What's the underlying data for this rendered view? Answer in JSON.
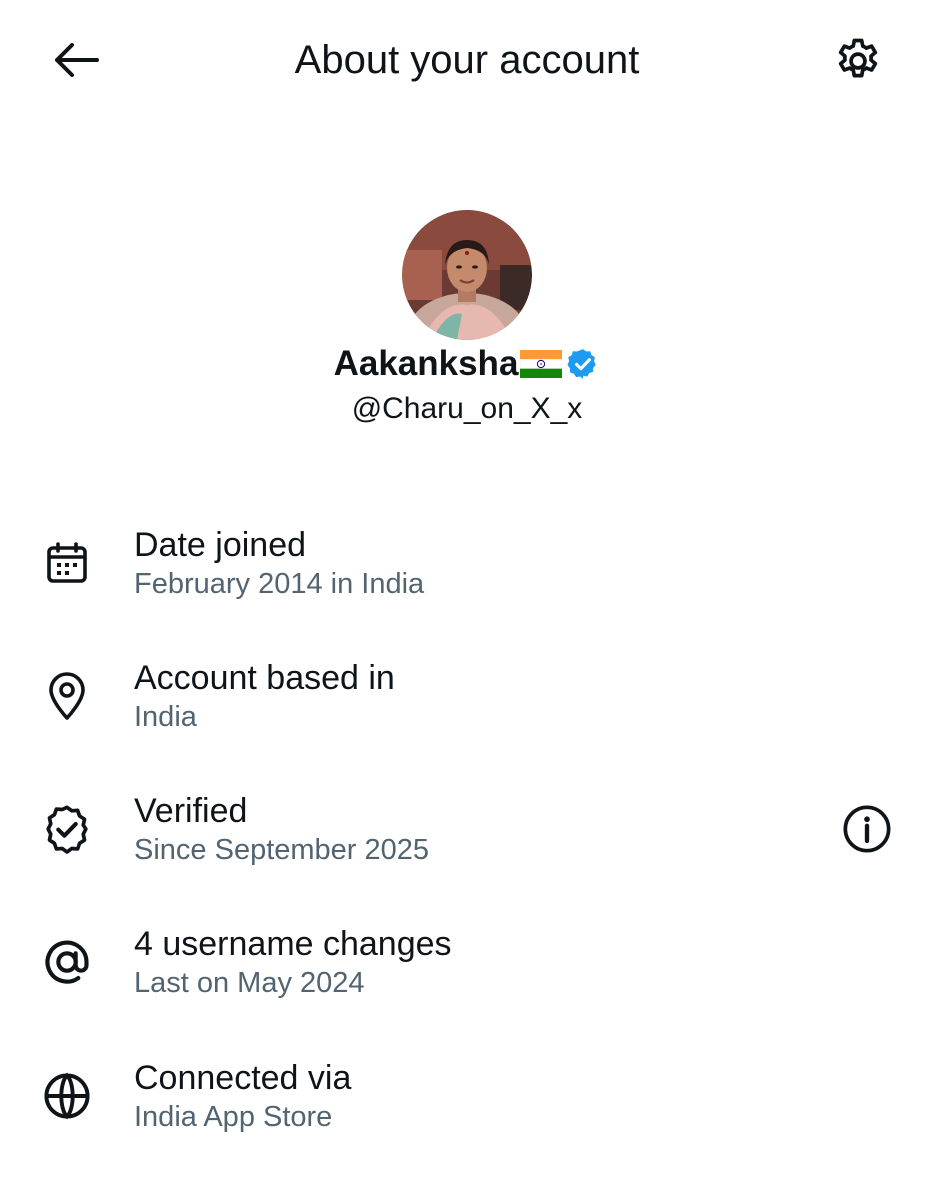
{
  "header": {
    "title": "About your account",
    "back_icon": "arrow-left-icon",
    "settings_icon": "gear-icon"
  },
  "profile": {
    "name": "Aakanksha",
    "flag": "india-flag-emoji",
    "verified_badge": "verified-badge-icon",
    "handle": "@Charu_on_X_x",
    "badge_color": "#1d9bf0"
  },
  "details": [
    {
      "icon": "calendar-icon",
      "label": "Date joined",
      "value": "February 2014 in India"
    },
    {
      "icon": "location-pin-icon",
      "label": "Account based in",
      "value": "India"
    },
    {
      "icon": "verified-outline-icon",
      "label": "Verified",
      "value": "Since September 2025",
      "info_icon": "info-icon"
    },
    {
      "icon": "at-sign-icon",
      "label": "4 username changes",
      "value": "Last on May 2024"
    },
    {
      "icon": "globe-icon",
      "label": "Connected via",
      "value": "India App Store"
    }
  ],
  "colors": {
    "text_primary": "#0f1419",
    "text_secondary": "#536471",
    "accent": "#1d9bf0"
  }
}
